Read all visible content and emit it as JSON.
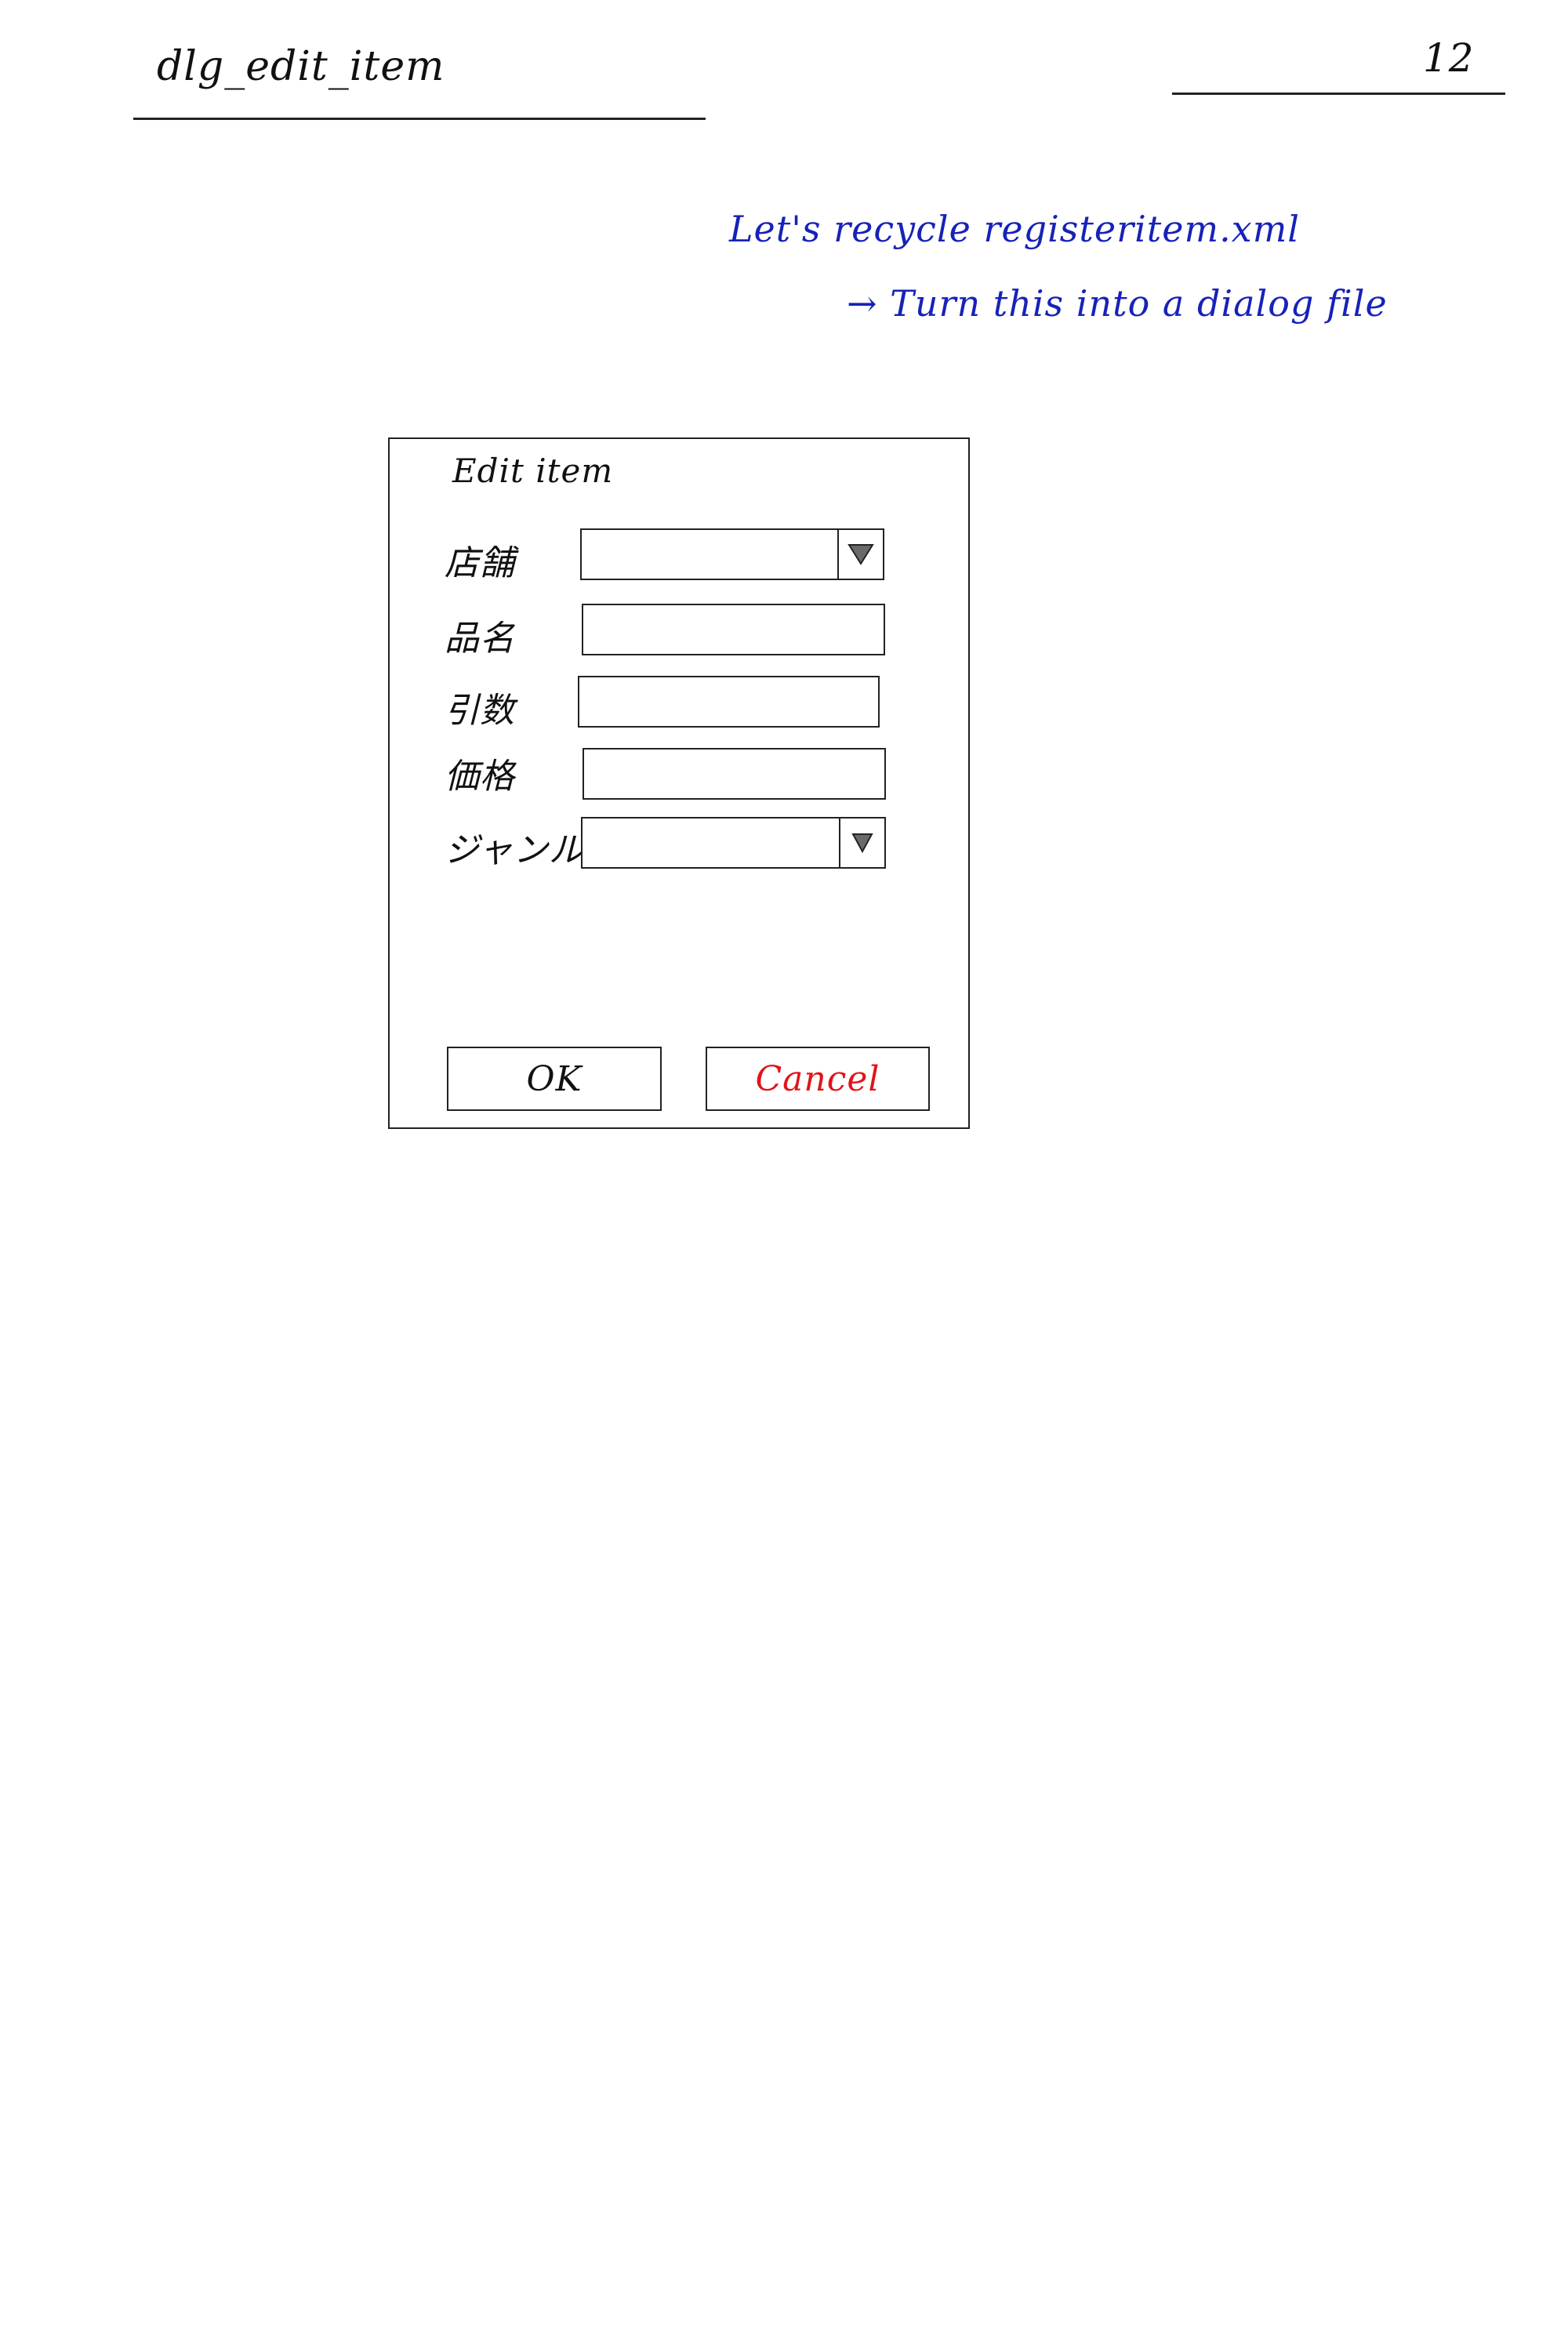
{
  "page": {
    "title": "dlg_edit_item",
    "number": "12"
  },
  "notes": {
    "line1": "Let's recycle registeritem.xml",
    "line2": "→ Turn this into a dialog file"
  },
  "dialog": {
    "title": "Edit item",
    "fields": [
      {
        "label": "店舗",
        "type": "dropdown",
        "value": "",
        "arrow_icon": "dropdown-arrow-icon"
      },
      {
        "label": "品名",
        "type": "text",
        "value": ""
      },
      {
        "label": "引数",
        "type": "text",
        "value": ""
      },
      {
        "label": "価格",
        "type": "text",
        "value": ""
      },
      {
        "label": "ジャンル",
        "type": "dropdown",
        "value": "",
        "arrow_icon": "dropdown-arrow-icon"
      }
    ],
    "ok_label": "OK",
    "cancel_label": "Cancel"
  },
  "colors": {
    "note_ink": "#1722b8",
    "cancel_ink": "#e0141a",
    "sketch_ink": "#222222",
    "arrow_fill": "#6a6a6a"
  }
}
